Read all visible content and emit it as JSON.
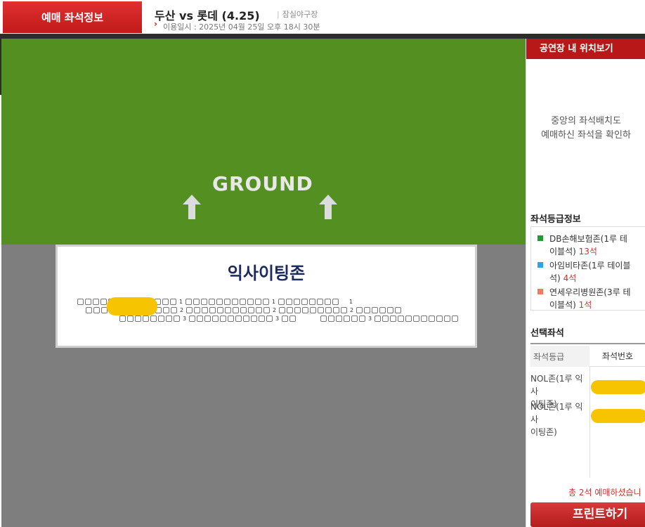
{
  "header": {
    "badge": "예매 좌석정보",
    "game_title": "두산 vs 롯데 (4.25)",
    "venue": "잠실야구장",
    "venue_sep": "|",
    "usage_date": "이용일시 : 2025년 04월 25일 오후 18시 30분"
  },
  "stadium": {
    "ground_label": "GROUND",
    "zone_title": "익사이팅존",
    "row_numbers": [
      "1",
      "2",
      "3"
    ]
  },
  "right_panel": {
    "location_title": "공연장 내 위치보기",
    "location_msg_1": "중앙의 좌석배치도",
    "location_msg_2": "예매하신 좌석을 확인하",
    "grade_title": "좌석등급정보",
    "grades": [
      {
        "name_1": "DB손해보험존(1루 테",
        "name_2": "이블석)",
        "count": "13석",
        "color": "#1f9d2e"
      },
      {
        "name_1": "아임비타존(1루 테이블",
        "name_2": "석)",
        "count": "4석",
        "color": "#2aa6e6"
      },
      {
        "name_1": "연세우리병원존(3루 테",
        "name_2": "이블석)",
        "count": "1석",
        "color": "#f07a5a"
      }
    ],
    "selected_title": "선택좌석",
    "col_grade": "좌석등급",
    "col_seat": "좌석번호",
    "selected": [
      {
        "grade_1": "NOL존(1루 익사",
        "grade_2": "이팅존)"
      },
      {
        "grade_1": "NOL존(1루 익사",
        "grade_2": "이팅존)"
      }
    ],
    "total": "총 2석 예매하셨습니",
    "print_label": "프린트하기"
  }
}
